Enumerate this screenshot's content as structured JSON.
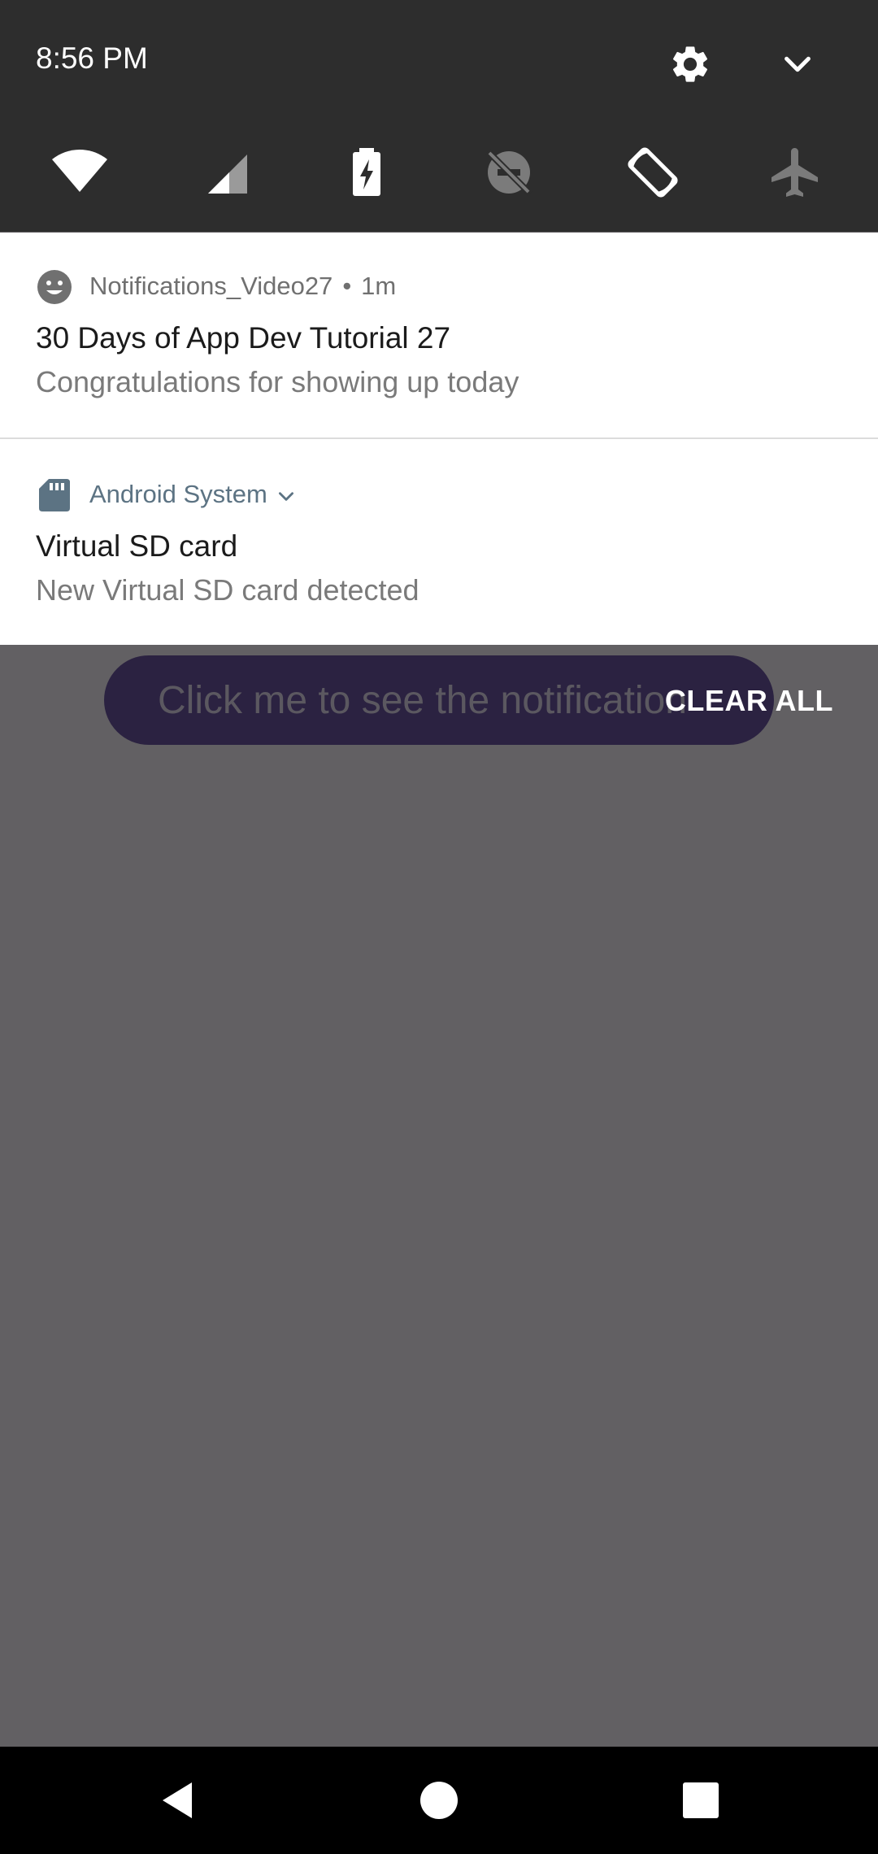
{
  "status_bar": {
    "time": "8:56 PM"
  },
  "quick_settings": {
    "tiles": [
      {
        "icon": "wifi-icon",
        "state": "on"
      },
      {
        "icon": "cellular-signal-icon",
        "state": "on"
      },
      {
        "icon": "battery-saver-icon",
        "state": "on"
      },
      {
        "icon": "do-not-disturb-icon",
        "state": "off"
      },
      {
        "icon": "auto-rotate-icon",
        "state": "on"
      },
      {
        "icon": "airplane-mode-icon",
        "state": "off"
      }
    ],
    "colors": {
      "background": "#2d2d2d",
      "tile_on": "#ffffff",
      "tile_off": "#7b7b7b"
    }
  },
  "notifications": [
    {
      "app_icon": "smiley-icon",
      "app_name": "Notifications_Video27",
      "separator": "•",
      "time": "1m",
      "title": "30 Days of App Dev Tutorial 27",
      "text": "Congratulations for showing up today"
    },
    {
      "app_icon": "sd-card-icon",
      "app_name": "Android System",
      "expand_icon": "chevron-down-icon",
      "title": "Virtual SD card",
      "text": "New Virtual SD card detected"
    }
  ],
  "shade": {
    "clear_all_label": "CLEAR ALL"
  },
  "app": {
    "button_label": "Click me to see the notification"
  },
  "navigation": {
    "buttons": [
      "back-icon",
      "home-icon",
      "recents-icon"
    ]
  }
}
